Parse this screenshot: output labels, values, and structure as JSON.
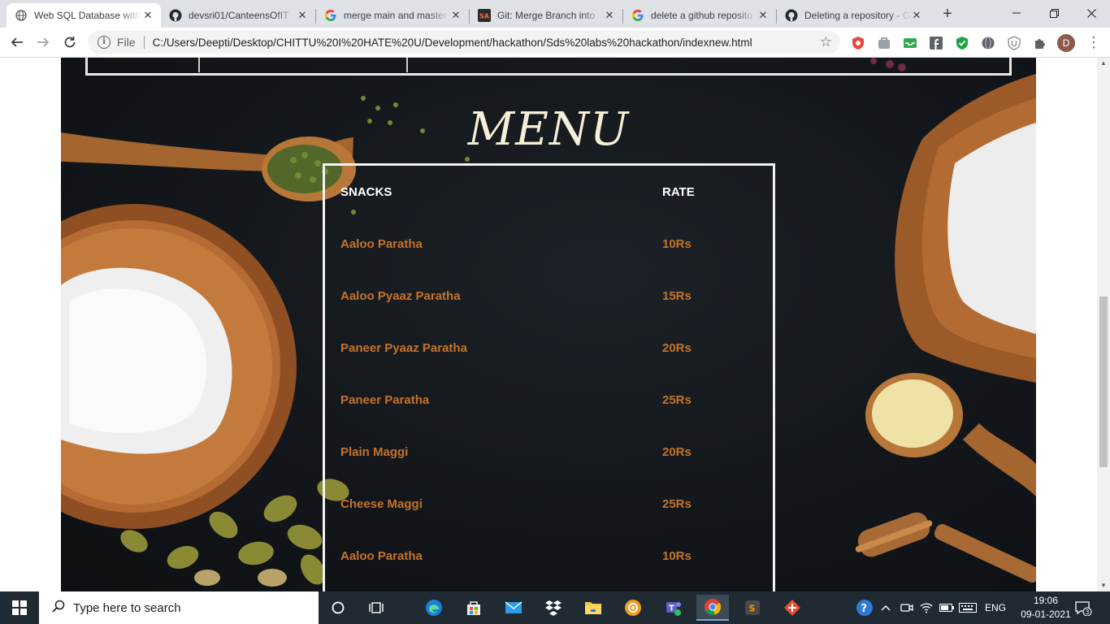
{
  "browser": {
    "tabs": [
      {
        "title": "Web SQL Database with",
        "icon": "globe-icon",
        "active": true
      },
      {
        "title": "devsri01/CanteensOfIT",
        "icon": "github-icon",
        "active": false
      },
      {
        "title": "merge main and master",
        "icon": "google-icon",
        "active": false
      },
      {
        "title": "Git: Merge Branch into",
        "icon": "sa-site-icon",
        "active": false
      },
      {
        "title": "delete a github reposito",
        "icon": "google-icon",
        "active": false
      },
      {
        "title": "Deleting a repository - G",
        "icon": "github-icon",
        "active": false
      }
    ],
    "new_tab_label": "+",
    "address": {
      "scheme_label": "File",
      "url": "C:/Users/Deepti/Desktop/CHITTU%20I%20HATE%20U/Development/hackathon/Sds%20labs%20hackathon/indexnew.html"
    },
    "profile_initial": "D"
  },
  "page": {
    "menu_title": "MENU",
    "menu": {
      "header": {
        "item": "SNACKS",
        "rate": "RATE"
      },
      "items": [
        {
          "name": "Aaloo Paratha",
          "rate": "10Rs"
        },
        {
          "name": "Aaloo Pyaaz Paratha",
          "rate": "15Rs"
        },
        {
          "name": "Paneer Pyaaz Paratha",
          "rate": "20Rs"
        },
        {
          "name": "Paneer Paratha",
          "rate": "25Rs"
        },
        {
          "name": "Plain Maggi",
          "rate": "20Rs"
        },
        {
          "name": "Cheese Maggi",
          "rate": "25Rs"
        },
        {
          "name": "Aaloo Paratha",
          "rate": "10Rs"
        }
      ]
    },
    "colors": {
      "item_text": "#c4732a",
      "header_text": "#ffffff",
      "title_text": "#f6f0d8"
    }
  },
  "taskbar": {
    "search_placeholder": "Type here to search",
    "language": "ENG",
    "time": "19:06",
    "date": "09-01-2021",
    "notification_count": "3"
  }
}
